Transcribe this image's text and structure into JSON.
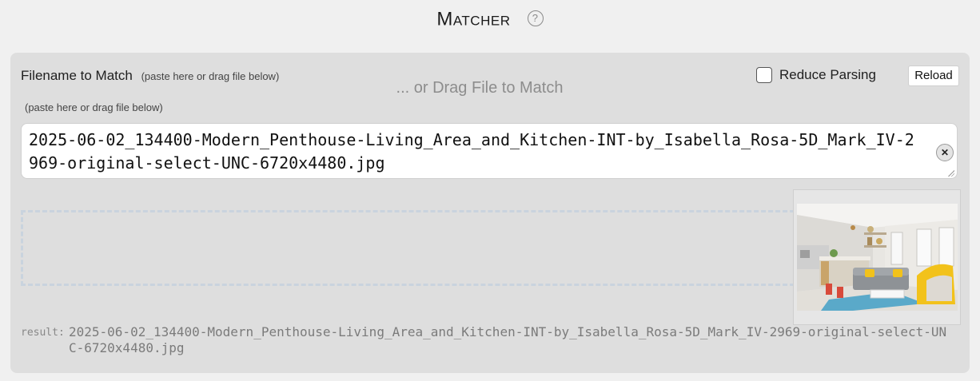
{
  "header": {
    "title": "Matcher",
    "help_glyph": "?",
    "help_icon": "help-circle-icon"
  },
  "form": {
    "label": "Filename to Match",
    "label_hint": "(paste here or drag file below)",
    "sub_hint": "(paste here or drag file below)",
    "reduce_parsing_label": "Reduce Parsing",
    "reduce_parsing_checked": false,
    "reload_label": "Reload",
    "filename_value": "2025-06-02_134400-Modern_Penthouse-Living_Area_and_Kitchen-INT-by_Isabella_Rosa-5D_Mark_IV-2969-original-select-UNC-6720x4480.jpg",
    "clear_glyph": "✕",
    "clear_icon": "clear-circle-icon",
    "drop_text": "... or Drag File to Match"
  },
  "result": {
    "label": "result:",
    "value": "2025-06-02_134400-Modern_Penthouse-Living_Area_and_Kitchen-INT-by_Isabella_Rosa-5D_Mark_IV-2969-original-select-UNC-6720x4480.jpg"
  },
  "colors": {
    "panel_bg": "#dedede",
    "page_bg": "#f0f0f0",
    "drop_border": "#c9d3de",
    "accent_yellow": "#f2c21b"
  }
}
